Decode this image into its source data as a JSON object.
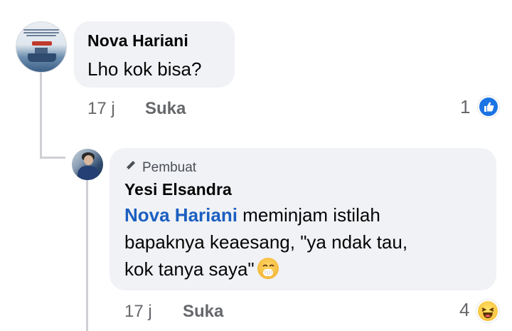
{
  "comment": {
    "author": "Nova Hariani",
    "text": "Lho kok bisa?",
    "time": "17 j",
    "like_label": "Suka",
    "reaction_count": "1",
    "reaction_icon": "like-icon"
  },
  "reply": {
    "badge_label": "Pembuat",
    "author": "Yesi Elsandra",
    "mention": "Nova Hariani",
    "text_line1": " meminjam istilah",
    "text_line2": "bapaknya keaesang, \"ya ndak tau,",
    "text_line3": "kok tanya saya\"",
    "emoji": "face-with-hand-over-mouth",
    "time": "17 j",
    "like_label": "Suka",
    "reaction_count": "4",
    "reaction_icon": "haha-icon"
  },
  "colors": {
    "bubble": "#f0f2f5",
    "mention": "#1b5fc1",
    "meta": "#65676b",
    "like_blue": "#1b74e4"
  }
}
